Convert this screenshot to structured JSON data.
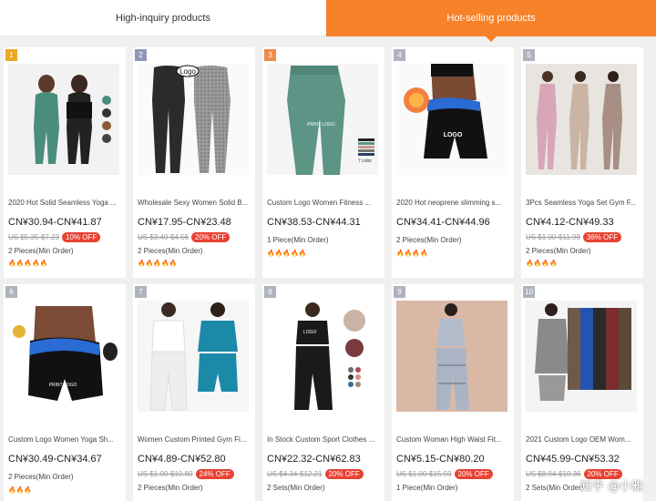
{
  "tabs": {
    "inquiry": "High-inquiry products",
    "selling": "Hot-selling products"
  },
  "products": [
    {
      "rank": "1",
      "title": "2020 Hot Solid Seamless Yoga ...",
      "price": "CN¥30.94-CN¥41.87",
      "old": "US $5.35-$7.23",
      "discount": "10% OFF",
      "moq": "2 Pieces(Min Order)",
      "fire": "🔥🔥🔥🔥🔥"
    },
    {
      "rank": "2",
      "title": "Wholesale Sexy Women Solid B...",
      "price": "CN¥17.95-CN¥23.48",
      "old": "US $3.49-$4.56",
      "discount": "20% OFF",
      "moq": "2 Pieces(Min Order)",
      "fire": "🔥🔥🔥🔥🔥"
    },
    {
      "rank": "3",
      "title": "Custom Logo Women Fitness ...",
      "price": "CN¥38.53-CN¥44.31",
      "old": "",
      "discount": "",
      "moq": "1 Piece(Min Order)",
      "fire": "🔥🔥🔥🔥🔥"
    },
    {
      "rank": "4",
      "title": "2020 Hot neoprene slimming s...",
      "price": "CN¥34.41-CN¥44.96",
      "old": "",
      "discount": "",
      "moq": "2 Pieces(Min Order)",
      "fire": "🔥🔥🔥🔥"
    },
    {
      "rank": "5",
      "title": "3Pcs Seamless Yoga Set Gym F...",
      "price": "CN¥4.12-CN¥49.33",
      "old": "US $1.00-$11.98",
      "discount": "36% OFF",
      "moq": "2 Pieces(Min Order)",
      "fire": "🔥🔥🔥🔥"
    },
    {
      "rank": "6",
      "title": "Custom Logo Women Yoga Sh...",
      "price": "CN¥30.49-CN¥34.67",
      "old": "",
      "discount": "",
      "moq": "2 Pieces(Min Order)",
      "fire": "🔥🔥🔥"
    },
    {
      "rank": "7",
      "title": "Women Custom Printed Gym Fi...",
      "price": "CN¥4.89-CN¥52.80",
      "old": "US $1.00-$10.80",
      "discount": "24% OFF",
      "moq": "2 Pieces(Min Order)",
      "fire": ""
    },
    {
      "rank": "8",
      "title": "In Stock Custom Sport Clothes ...",
      "price": "CN¥22.32-CN¥62.83",
      "old": "US $4.34-$12.21",
      "discount": "20% OFF",
      "moq": "2 Sets(Min Order)",
      "fire": ""
    },
    {
      "rank": "9",
      "title": "Custom Woman High Waist Fit...",
      "price": "CN¥5.15-CN¥80.20",
      "old": "US $1.00-$15.59",
      "discount": "20% OFF",
      "moq": "1 Piece(Min Order)",
      "fire": ""
    },
    {
      "rank": "10",
      "title": "2021 Custom Logo OEM Wom...",
      "price": "CN¥45.99-CN¥53.32",
      "old": "US $8.94-$10.36",
      "discount": "20% OFF",
      "moq": "2 Sets(Min Order)",
      "fire": ""
    }
  ],
  "image_labels": {
    "logo": "Logo",
    "print_logo": "PRINT LOGO",
    "logo_caps": "LOGO",
    "colors": "7 color"
  },
  "watermark": "知乎 @小雅"
}
